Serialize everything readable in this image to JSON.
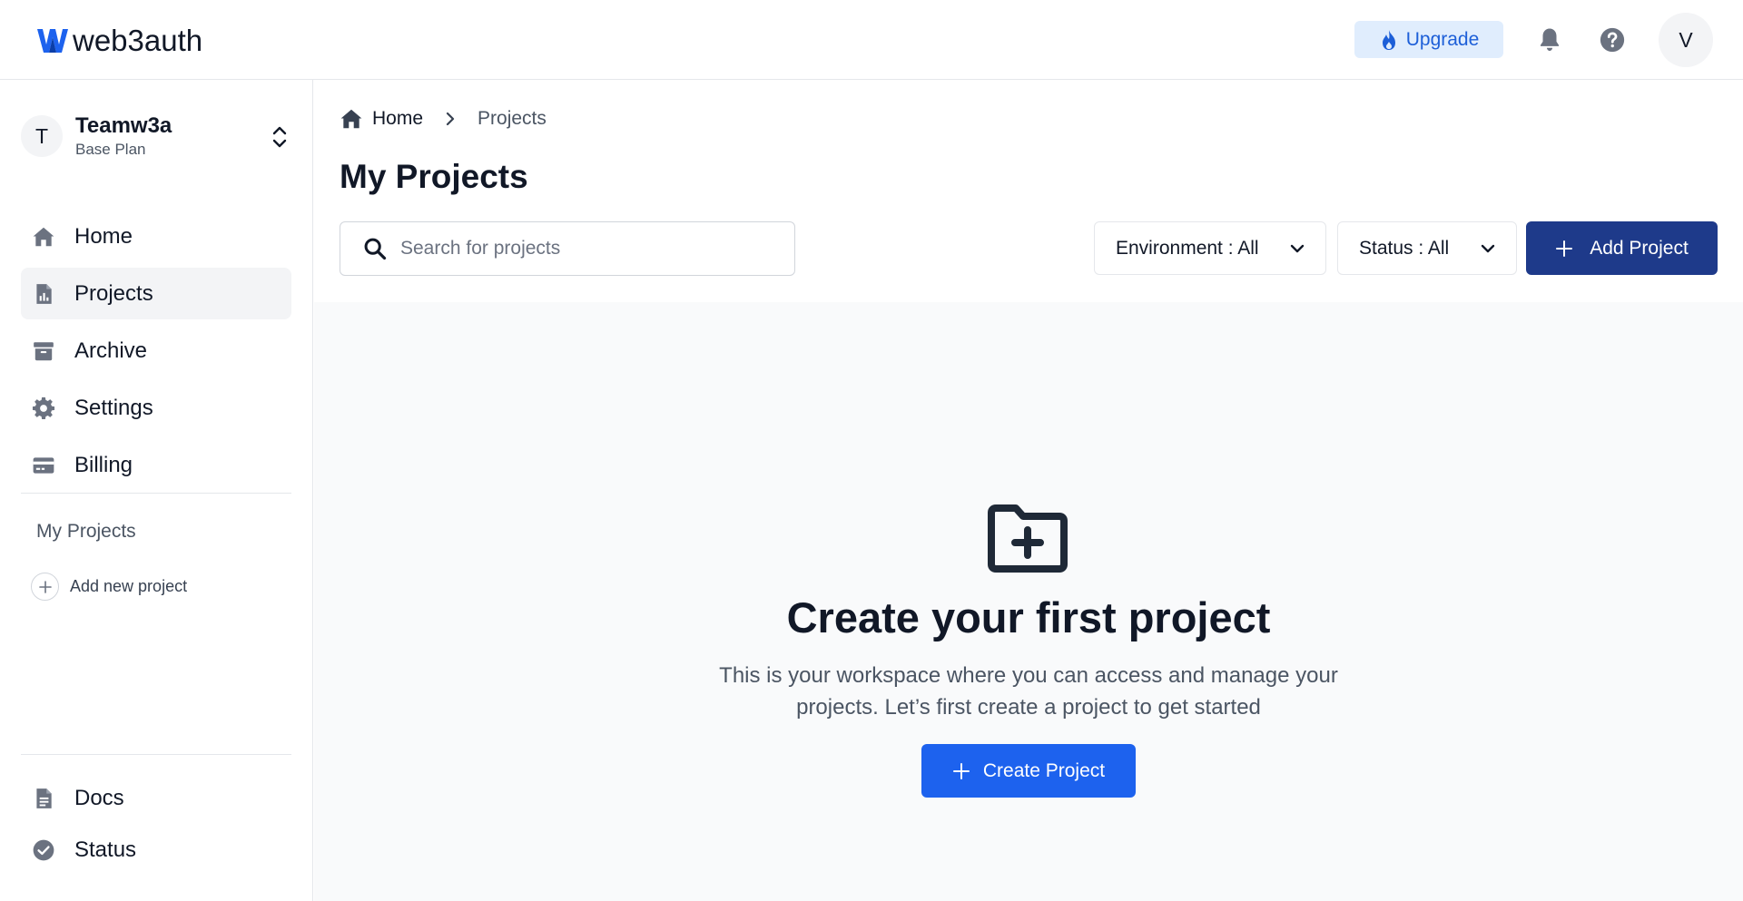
{
  "header": {
    "brand": "web3auth",
    "upgrade_label": "Upgrade",
    "avatar_initial": "V",
    "icons": [
      "flame-icon",
      "bell-icon",
      "help-icon"
    ]
  },
  "sidebar": {
    "team": {
      "initial": "T",
      "name": "Teamw3a",
      "plan": "Base Plan"
    },
    "items": [
      {
        "label": "Home",
        "icon": "home-icon"
      },
      {
        "label": "Projects",
        "icon": "projects-icon",
        "active": true
      },
      {
        "label": "Archive",
        "icon": "archive-icon"
      },
      {
        "label": "Settings",
        "icon": "gear-icon"
      },
      {
        "label": "Billing",
        "icon": "credit-card-icon"
      }
    ],
    "section_title": "My Projects",
    "add_new_label": "Add new project",
    "bottom_items": [
      {
        "label": "Docs",
        "icon": "document-icon"
      },
      {
        "label": "Status",
        "icon": "check-circle-icon"
      }
    ]
  },
  "main": {
    "breadcrumb": {
      "home": "Home",
      "current": "Projects"
    },
    "title": "My Projects",
    "search_placeholder": "Search for projects",
    "filters": {
      "environment": "Environment : All",
      "status": "Status : All"
    },
    "add_project_label": "Add Project",
    "empty": {
      "title": "Create your first project",
      "description": "This is your workspace where you can access and manage your projects. Let’s first create a project to get started",
      "button": "Create Project"
    }
  },
  "colors": {
    "primary_dark": "#1e3a8a",
    "primary": "#1d62ee",
    "upgrade_bg": "#e0edfd",
    "text": "#111827",
    "muted": "#4b5563"
  }
}
